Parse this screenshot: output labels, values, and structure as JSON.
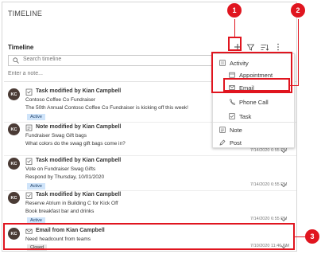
{
  "panel_title": "TIMELINE",
  "timeline_label": "Timeline",
  "search_placeholder": "Search timeline",
  "note_placeholder": "Enter a note...",
  "items": [
    {
      "avatar": "KC",
      "title": "Task modified by Kian Campbell",
      "line1": "Contoso Coffee Co Fundraiser",
      "line2": "The 50th Annual Contoso Coffee Co Fundraiser is kicking off this week!",
      "badge": "Active",
      "time": "7/14/2020 6:55 PM",
      "icon": "task-icon"
    },
    {
      "avatar": "KC",
      "title": "Note modified by Kian Campbell",
      "line1": "Fundraiser Swag Gift bags",
      "line2": "What colors do the swag gift bags come in?",
      "badge": "",
      "time": "7/14/2020 6:55 PM",
      "icon": "note-icon"
    },
    {
      "avatar": "KC",
      "title": "Task modified by Kian Campbell",
      "line1": "Vote on Fundraiser Swag Gifts",
      "line2": "Respond by Thursday, 10/01/2020",
      "badge": "Active",
      "time": "7/14/2020 6:55 PM",
      "icon": "task-icon"
    },
    {
      "avatar": "KC",
      "title": "Task modified by Kian Campbell",
      "line1": "Reserve Atrium in Building C for Kick Off",
      "line2": "Book breakfast bar and drinks",
      "badge": "Active",
      "time": "7/14/2020 6:55 PM",
      "icon": "task-icon"
    },
    {
      "avatar": "KC",
      "title": "Email from Kian Campbell",
      "line1": "Need headcount from teams",
      "line2": "",
      "badge": "Closed",
      "time": "7/10/2020 11:46 PM",
      "icon": "email-icon"
    }
  ],
  "menu": {
    "activity": "Activity",
    "appointment": "Appointment",
    "email": "Email",
    "phone_call": "Phone Call",
    "task": "Task",
    "note": "Note",
    "post": "Post"
  },
  "callouts": {
    "one": "1",
    "two": "2",
    "three": "3"
  }
}
